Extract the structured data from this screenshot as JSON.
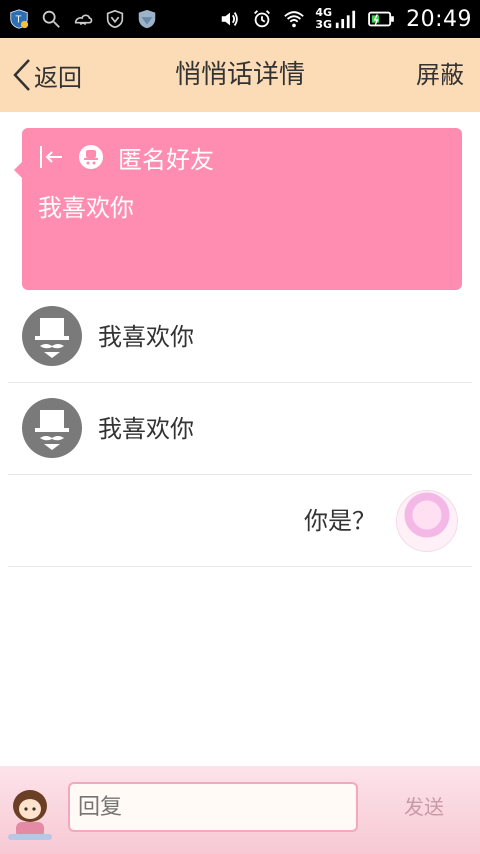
{
  "status_bar": {
    "time": "20:49",
    "net1": "4G",
    "net2": "3G"
  },
  "header": {
    "back_label": "返回",
    "title": "悄悄话详情",
    "block_label": "屏蔽"
  },
  "card": {
    "sender": "匿名好友",
    "message": "我喜欢你"
  },
  "replies": [
    {
      "text": "我喜欢你"
    },
    {
      "text": "我喜欢你"
    },
    {
      "text": "你是？"
    }
  ],
  "composer": {
    "placeholder": "回复",
    "send_label": "发送"
  },
  "colors": {
    "header_bg": "#fcdcb6",
    "card_bg": "#ff8db2",
    "bottom_bg": "#fde3ea"
  }
}
